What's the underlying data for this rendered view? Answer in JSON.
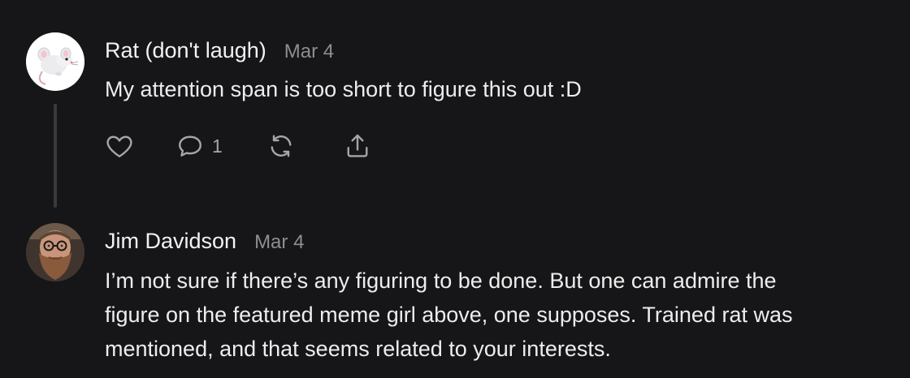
{
  "comments": [
    {
      "author": "Rat (don't laugh)",
      "date": "Mar 4",
      "text": "My attention span is too short to figure this out :D",
      "avatar_icon": "rat-avatar-icon",
      "reply_count": "1"
    },
    {
      "author": "Jim Davidson",
      "date": "Mar 4",
      "text": "I’m not sure if there’s any figuring to be done. But one can admire the\nfigure on the featured meme girl above, one supposes. Trained rat was\nmentioned, and that seems related to your interests.",
      "avatar_icon": "bearded-man-avatar-icon"
    }
  ],
  "colors": {
    "background": "#161618",
    "text": "#ededed",
    "muted": "#8e8e92",
    "icon": "#a6a6aa",
    "thread_line": "#3a3a3c"
  }
}
